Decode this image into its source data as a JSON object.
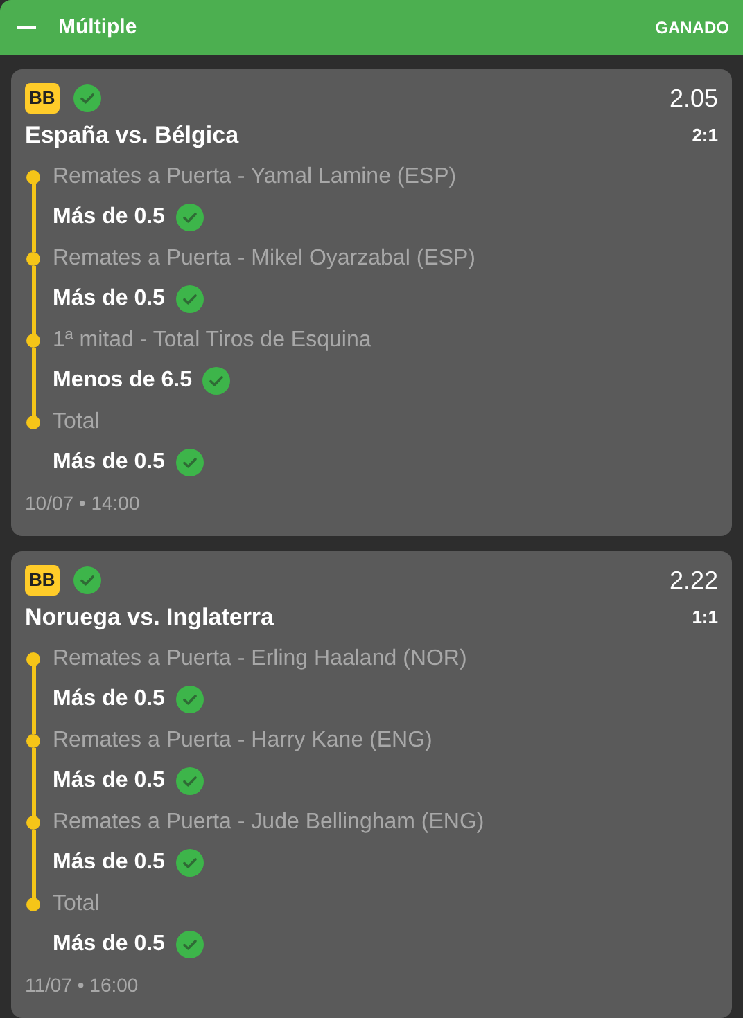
{
  "header": {
    "expanded": true,
    "title": "Múltiple",
    "status": "GANADO"
  },
  "bets": [
    {
      "badge": "BB",
      "won": true,
      "odds": "2.05",
      "match": "España vs. Bélgica",
      "score": "2:1",
      "date": "10/07 • 14:00",
      "selections": [
        {
          "market": "Remates a Puerta - Yamal Lamine (ESP)",
          "pick": "Más de 0.5",
          "won": true
        },
        {
          "market": "Remates a Puerta - Mikel Oyarzabal (ESP)",
          "pick": "Más de 0.5",
          "won": true
        },
        {
          "market": "1ª mitad - Total Tiros de Esquina",
          "pick": "Menos de 6.5",
          "won": true
        },
        {
          "market": "Total",
          "pick": "Más de 0.5",
          "won": true
        }
      ]
    },
    {
      "badge": "BB",
      "won": true,
      "odds": "2.22",
      "match": "Noruega vs. Inglaterra",
      "score": "1:1",
      "date": "11/07 • 16:00",
      "selections": [
        {
          "market": "Remates a Puerta - Erling Haaland (NOR)",
          "pick": "Más de 0.5",
          "won": true
        },
        {
          "market": "Remates a Puerta - Harry Kane (ENG)",
          "pick": "Más de 0.5",
          "won": true
        },
        {
          "market": "Remates a Puerta - Jude Bellingham (ENG)",
          "pick": "Más de 0.5",
          "won": true
        },
        {
          "market": "Total",
          "pick": "Más de 0.5",
          "won": true
        }
      ]
    }
  ]
}
